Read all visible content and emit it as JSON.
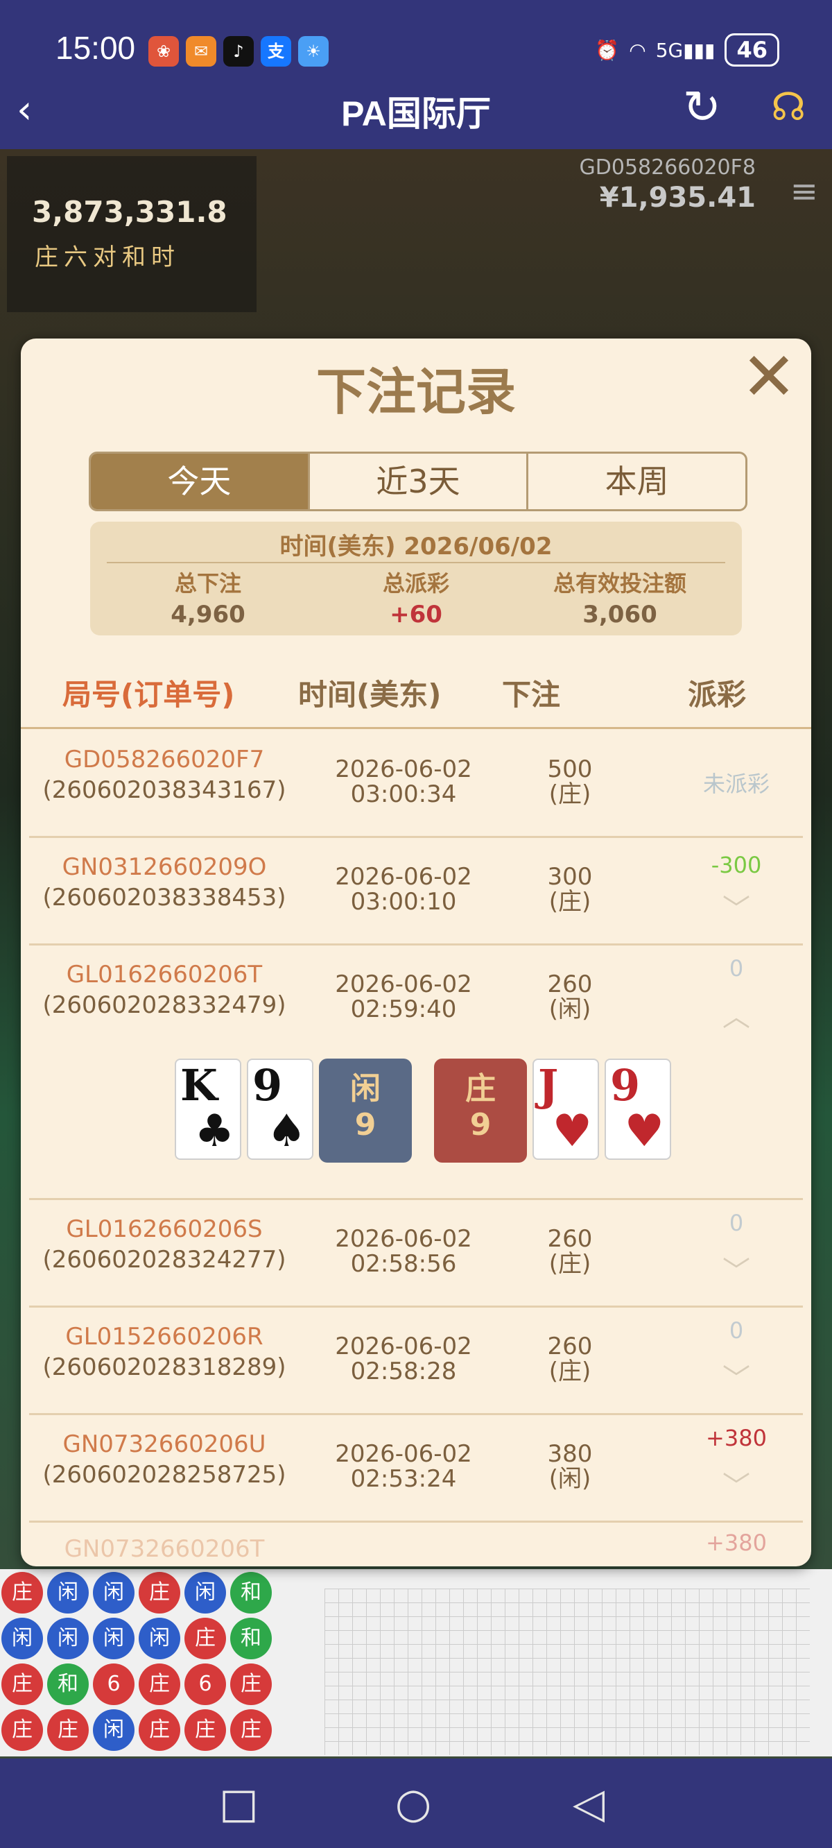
{
  "status_bar": {
    "time": "15:00",
    "battery": "46",
    "network": "5G"
  },
  "header": {
    "title": "PA国际厅"
  },
  "game": {
    "live_value": "3,873,331.8",
    "sides_label": "庄六对和时",
    "round_id": "GD058266020F8",
    "balance": "¥1,935.41"
  },
  "modal": {
    "title": "下注记录",
    "tabs": [
      {
        "label": "今天",
        "active": true
      },
      {
        "label": "近3天",
        "active": false
      },
      {
        "label": "本周",
        "active": false
      }
    ],
    "summary": {
      "date": "时间(美东) 2026/06/02",
      "total_bet_label": "总下注",
      "total_bet": "4,960",
      "total_payout_label": "总派彩",
      "total_payout": "+60",
      "total_valid_label": "总有效投注额",
      "total_valid": "3,060"
    },
    "columns": [
      "局号(订单号)",
      "时间(美东)",
      "下注",
      "派彩"
    ],
    "rows": [
      {
        "game_id": "GD058266020F7",
        "order": "(260602038343167)",
        "date": "2026-06-02",
        "time": "03:00:34",
        "bet": "500",
        "side": "(庄)",
        "payout": "未派彩"
      },
      {
        "game_id": "GN0312660209O",
        "order": "(260602038338453)",
        "date": "2026-06-02",
        "time": "03:00:10",
        "bet": "300",
        "side": "(庄)",
        "payout": "-300"
      },
      {
        "game_id": "GL0162660206T",
        "order": "(260602028332479)",
        "date": "2026-06-02",
        "time": "02:59:40",
        "bet": "260",
        "side": "(闲)",
        "payout": "0"
      },
      {
        "game_id": "GL0162660206S",
        "order": "(260602028324277)",
        "date": "2026-06-02",
        "time": "02:58:56",
        "bet": "260",
        "side": "(庄)",
        "payout": "0"
      },
      {
        "game_id": "GL0152660206R",
        "order": "(260602028318289)",
        "date": "2026-06-02",
        "time": "02:58:28",
        "bet": "260",
        "side": "(庄)",
        "payout": "0"
      },
      {
        "game_id": "GN0732660206U",
        "order": "(260602028258725)",
        "date": "2026-06-02",
        "time": "02:53:24",
        "bet": "380",
        "side": "(闲)",
        "payout": "+380"
      },
      {
        "game_id": "GN0732660206T",
        "payout": "+380"
      }
    ],
    "expanded_result": {
      "player_cards": [
        {
          "rank": "K",
          "suit": "♣"
        },
        {
          "rank": "9",
          "suit": "♠"
        }
      ],
      "player_label": "闲",
      "player_score": "9",
      "banker_label": "庄",
      "banker_score": "9",
      "banker_cards": [
        {
          "rank": "J",
          "suit": "♥"
        },
        {
          "rank": "9",
          "suit": "♥"
        }
      ]
    }
  },
  "colors": {
    "accent": "#a2804c",
    "bg": "#fbf0de",
    "negative": "#7ac943",
    "positive": "#c0343a",
    "header": "#33357a"
  }
}
